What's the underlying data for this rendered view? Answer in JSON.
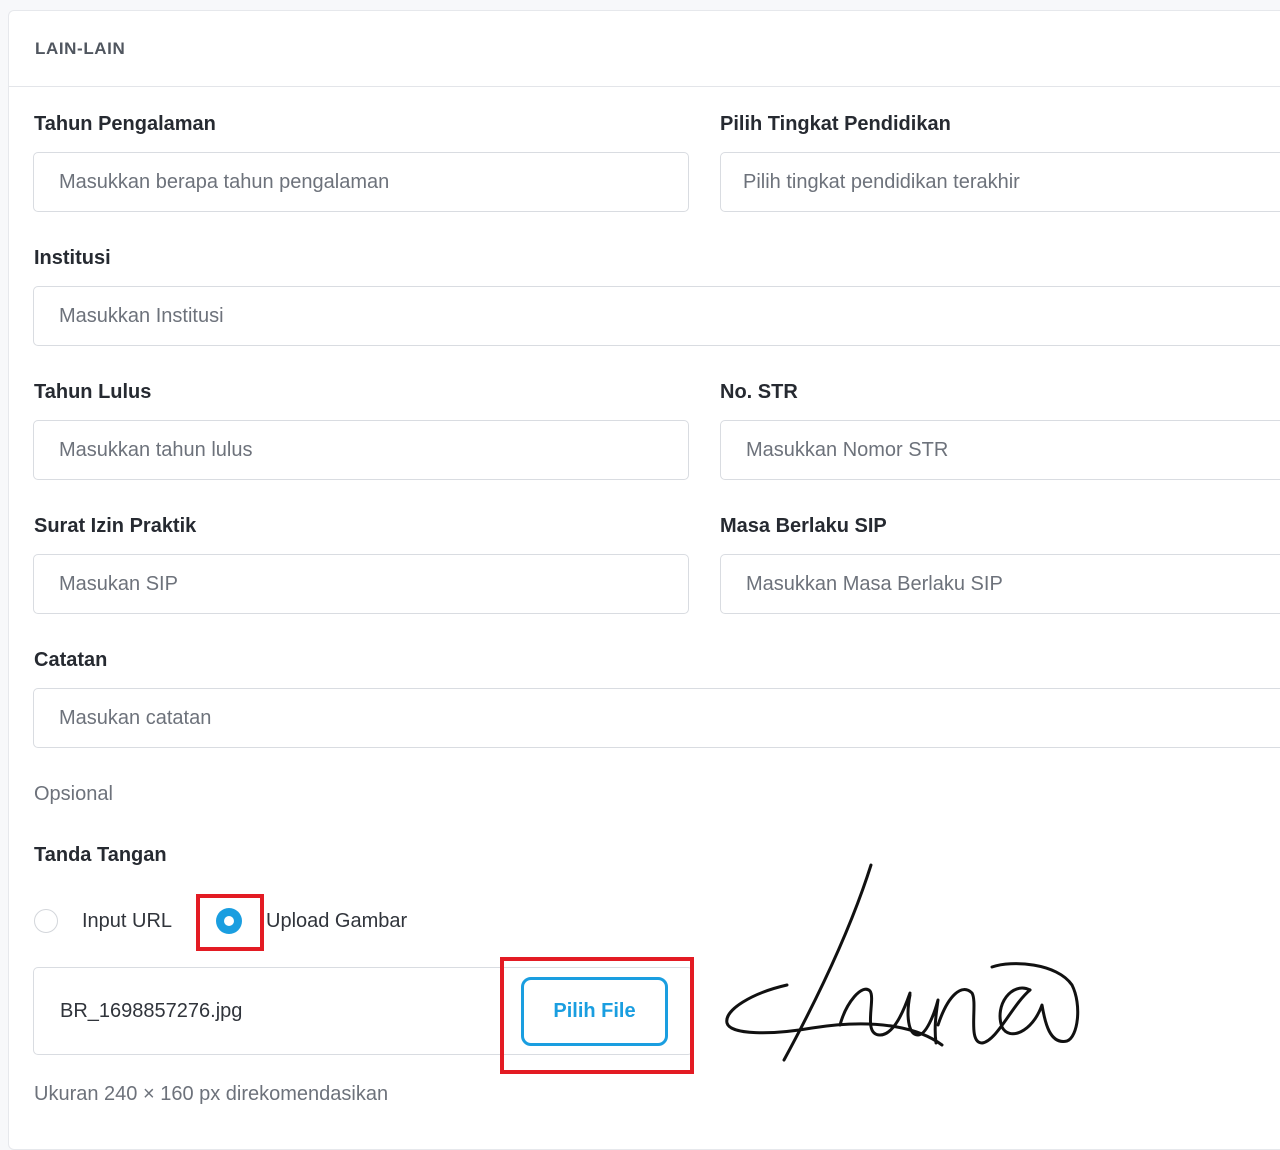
{
  "section": {
    "title": "LAIN-LAIN"
  },
  "fields": {
    "experience": {
      "label": "Tahun Pengalaman",
      "placeholder": "Masukkan berapa tahun pengalaman"
    },
    "education": {
      "label": "Pilih Tingkat Pendidikan",
      "placeholder": "Pilih tingkat pendidikan terakhir"
    },
    "institution": {
      "label": "Institusi",
      "placeholder": "Masukkan Institusi"
    },
    "graduation_year": {
      "label": "Tahun Lulus",
      "placeholder": "Masukkan tahun lulus"
    },
    "str_number": {
      "label": "No. STR",
      "placeholder": "Masukkan Nomor STR"
    },
    "sip": {
      "label": "Surat Izin Praktik",
      "placeholder": "Masukan SIP"
    },
    "sip_validity": {
      "label": "Masa Berlaku SIP",
      "placeholder": "Masukkan Masa Berlaku SIP"
    },
    "notes": {
      "label": "Catatan",
      "placeholder": "Masukan catatan",
      "hint": "Opsional"
    }
  },
  "signature": {
    "label": "Tanda Tangan",
    "options": [
      {
        "label": "Input URL",
        "selected": false
      },
      {
        "label": "Upload Gambar",
        "selected": true
      }
    ],
    "file_name": "BR_1698857276.jpg",
    "pick_button": "Pilih File",
    "hint": "Ukuran 240 × 160 px direkomendasikan",
    "image_text": "Luna"
  },
  "colors": {
    "accent": "#1a9ee0",
    "highlight": "#e31b23"
  }
}
